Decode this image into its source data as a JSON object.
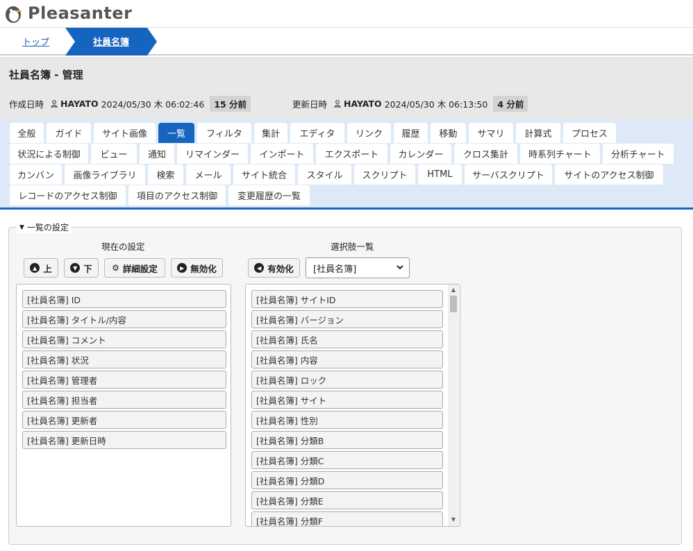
{
  "app": {
    "name": "Pleasanter"
  },
  "breadcrumb": {
    "top": "トップ",
    "current": "社員名簿"
  },
  "page": {
    "title": "社員名簿 - 管理",
    "created_label": "作成日時",
    "created_user": "HAYATO",
    "created_date": "2024/05/30 木 06:02:46",
    "created_ago": "15 分前",
    "updated_label": "更新日時",
    "updated_user": "HAYATO",
    "updated_date": "2024/05/30 木 06:13:50",
    "updated_ago": "4 分前"
  },
  "tabs": [
    "全般",
    "ガイド",
    "サイト画像",
    "一覧",
    "フィルタ",
    "集計",
    "エディタ",
    "リンク",
    "履歴",
    "移動",
    "サマリ",
    "計算式",
    "プロセス",
    "状況による制御",
    "ビュー",
    "通知",
    "リマインダー",
    "インポート",
    "エクスポート",
    "カレンダー",
    "クロス集計",
    "時系列チャート",
    "分析チャート",
    "カンバン",
    "画像ライブラリ",
    "検索",
    "メール",
    "サイト統合",
    "スタイル",
    "スクリプト",
    "HTML",
    "サーバスクリプト",
    "サイトのアクセス制御",
    "レコードのアクセス制御",
    "項目のアクセス制御",
    "変更履歴の一覧"
  ],
  "active_tab": "一覧",
  "section": {
    "legend": "一覧の設定",
    "current_heading": "現在の設定",
    "options_heading": "選択肢一覧",
    "btn_up": "上",
    "btn_down": "下",
    "btn_detail": "詳細設定",
    "btn_disable": "無効化",
    "btn_enable": "有効化",
    "select_value": "[社員名簿]"
  },
  "current_items": [
    "[社員名簿] ID",
    "[社員名簿] タイトル/内容",
    "[社員名簿] コメント",
    "[社員名簿] 状況",
    "[社員名簿] 管理者",
    "[社員名簿] 担当者",
    "[社員名簿] 更新者",
    "[社員名簿] 更新日時"
  ],
  "option_items": [
    "[社員名簿] サイトID",
    "[社員名簿] バージョン",
    "[社員名簿] 氏名",
    "[社員名簿] 内容",
    "[社員名簿] ロック",
    "[社員名簿] サイト",
    "[社員名簿] 性別",
    "[社員名簿] 分類B",
    "[社員名簿] 分類C",
    "[社員名簿] 分類D",
    "[社員名簿] 分類E",
    "[社員名簿] 分類F"
  ],
  "colors": {
    "accent": "#1565c0",
    "tab_strip": "#dde9f7"
  }
}
